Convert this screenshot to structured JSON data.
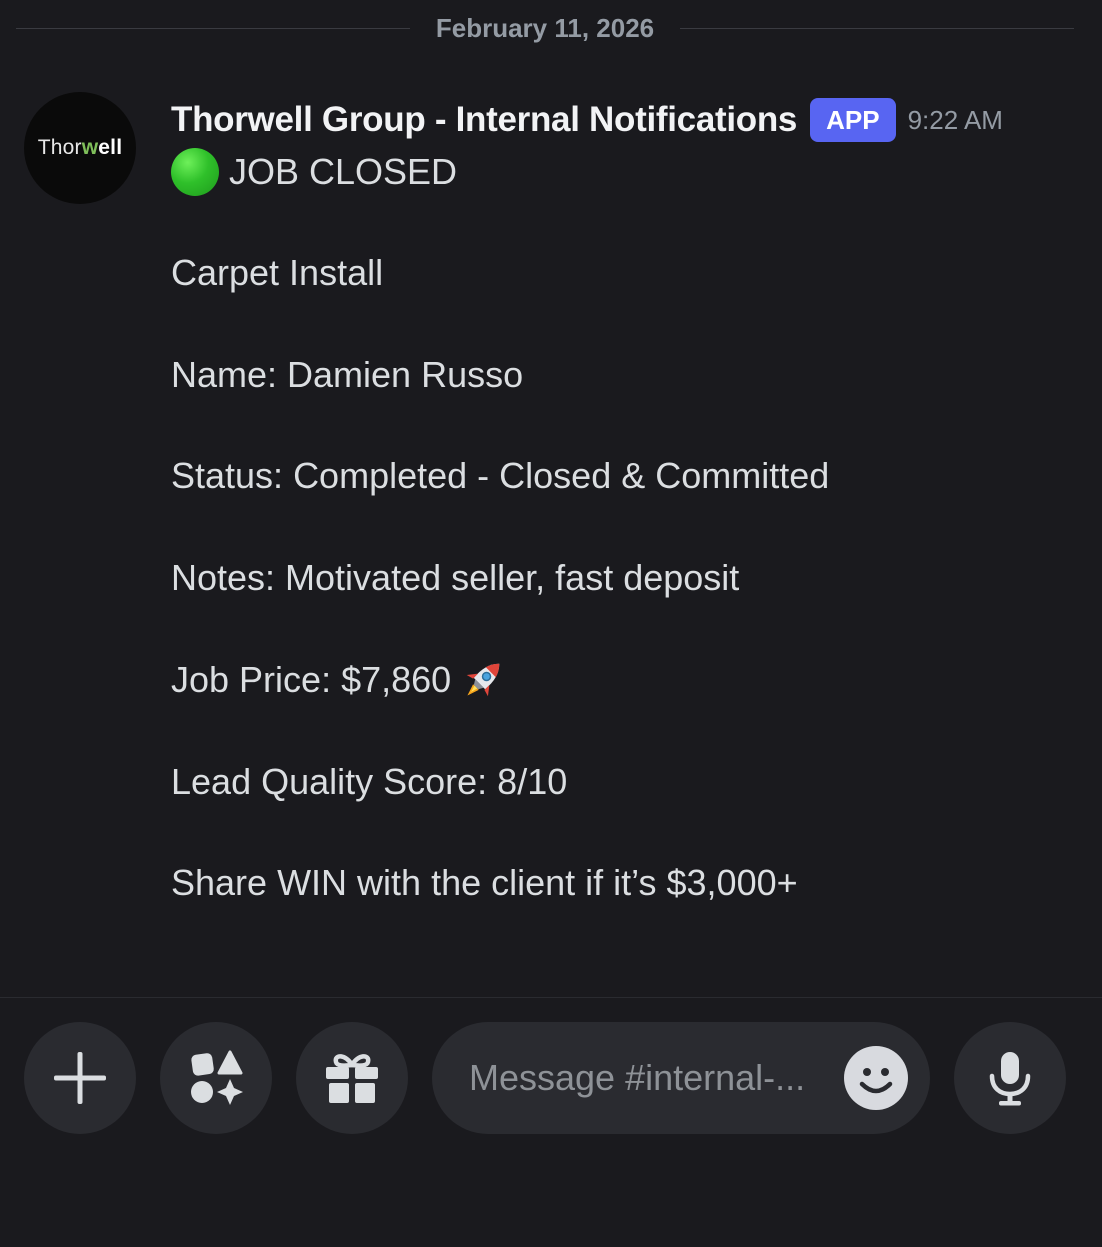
{
  "date_divider": "February 11, 2026",
  "avatar": {
    "logo_prefix": "Thor",
    "logo_suffix": "well",
    "logo_colors": {
      "text": "#e8e8e8",
      "accent": "#7fbf5a"
    }
  },
  "message": {
    "author": "Thorwell Group - Internal Notifications",
    "badge": "APP",
    "timestamp": "9:22 AM",
    "status_icon": "green-circle-emoji",
    "status": "JOB CLOSED",
    "lines": {
      "job_type": "Carpet Install",
      "name": "Name: Damien Russo",
      "status": "Status: Completed - Closed & Committed",
      "notes": "Notes: Motivated seller, fast deposit",
      "price": "Job Price: $7,860",
      "price_icon": "rocket-emoji",
      "lead_score": "Lead Quality Score: 8/10",
      "share": "Share WIN with the client if it’s $3,000+"
    }
  },
  "composer": {
    "placeholder": "Message #internal-...",
    "buttons": [
      "plus-icon",
      "apps-icon",
      "gift-icon",
      "emoji-icon",
      "microphone-icon"
    ]
  },
  "colors": {
    "background": "#1a1a1e",
    "accent": "#5865f2",
    "text": "#dbdee1",
    "muted": "#949ba4",
    "control": "#2a2b30"
  }
}
